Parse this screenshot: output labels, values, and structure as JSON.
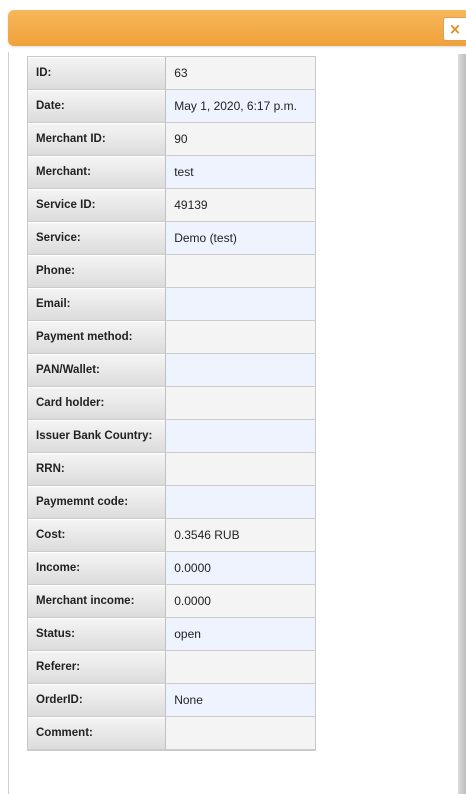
{
  "dialog": {
    "close_label": "×"
  },
  "details": {
    "rows": [
      {
        "label": "ID:",
        "value": "63"
      },
      {
        "label": "Date:",
        "value": "May 1, 2020, 6:17 p.m."
      },
      {
        "label": "Merchant ID:",
        "value": "90"
      },
      {
        "label": "Merchant:",
        "value": "test"
      },
      {
        "label": "Service ID:",
        "value": "49139"
      },
      {
        "label": "Service:",
        "value": "Demo (test)"
      },
      {
        "label": "Phone:",
        "value": ""
      },
      {
        "label": "Email:",
        "value": ""
      },
      {
        "label": "Payment method:",
        "value": ""
      },
      {
        "label": "PAN/Wallet:",
        "value": ""
      },
      {
        "label": "Card holder:",
        "value": ""
      },
      {
        "label": "Issuer Bank Country:",
        "value": ""
      },
      {
        "label": "RRN:",
        "value": ""
      },
      {
        "label": "Paymemnt code:",
        "value": ""
      },
      {
        "label": "Cost:",
        "value": "0.3546 RUB"
      },
      {
        "label": "Income:",
        "value": "0.0000"
      },
      {
        "label": "Merchant income:",
        "value": "0.0000"
      },
      {
        "label": "Status:",
        "value": "open"
      },
      {
        "label": "Referer:",
        "value": ""
      },
      {
        "label": "OrderID:",
        "value": "None"
      },
      {
        "label": "Comment:",
        "value": ""
      }
    ]
  },
  "colors": {
    "titlebar": "#efa23a",
    "close_icon": "#e58b1f",
    "value_alt": "#eef3fd"
  }
}
